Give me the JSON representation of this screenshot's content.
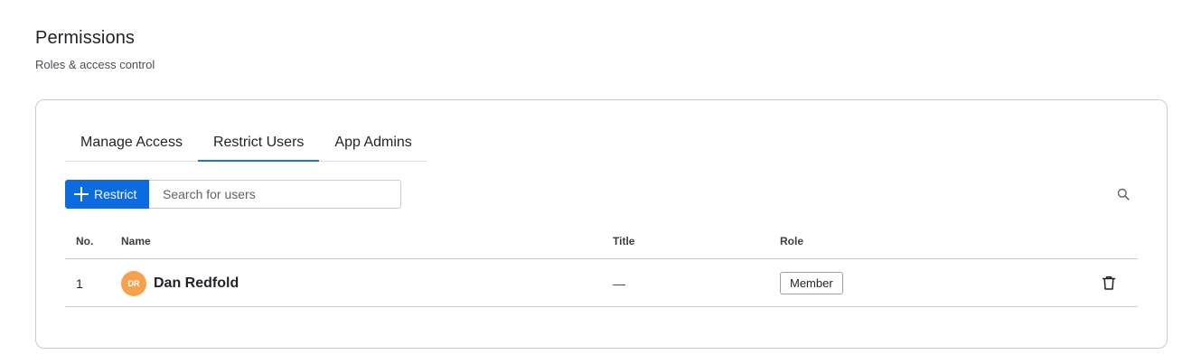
{
  "header": {
    "title": "Permissions",
    "subtitle": "Roles & access control"
  },
  "tabs": [
    {
      "label": "Manage Access",
      "active": false
    },
    {
      "label": "Restrict Users",
      "active": true
    },
    {
      "label": "App Admins",
      "active": false
    }
  ],
  "toolbar": {
    "restrict_label": "Restrict",
    "search_placeholder": "Search for users",
    "search_value": ""
  },
  "table": {
    "columns": [
      "No.",
      "Name",
      "Title",
      "Role"
    ],
    "rows": [
      {
        "no": "1",
        "initials": "DR",
        "name": "Dan Redfold",
        "title": "—",
        "role": "Member"
      }
    ]
  },
  "icons": {
    "plus": "plus-icon",
    "search": "search-icon",
    "trash": "trash-icon"
  },
  "colors": {
    "accent": "#0b6bdf",
    "tab_indicator": "#1a73e8",
    "avatar": "#f6a14b"
  }
}
